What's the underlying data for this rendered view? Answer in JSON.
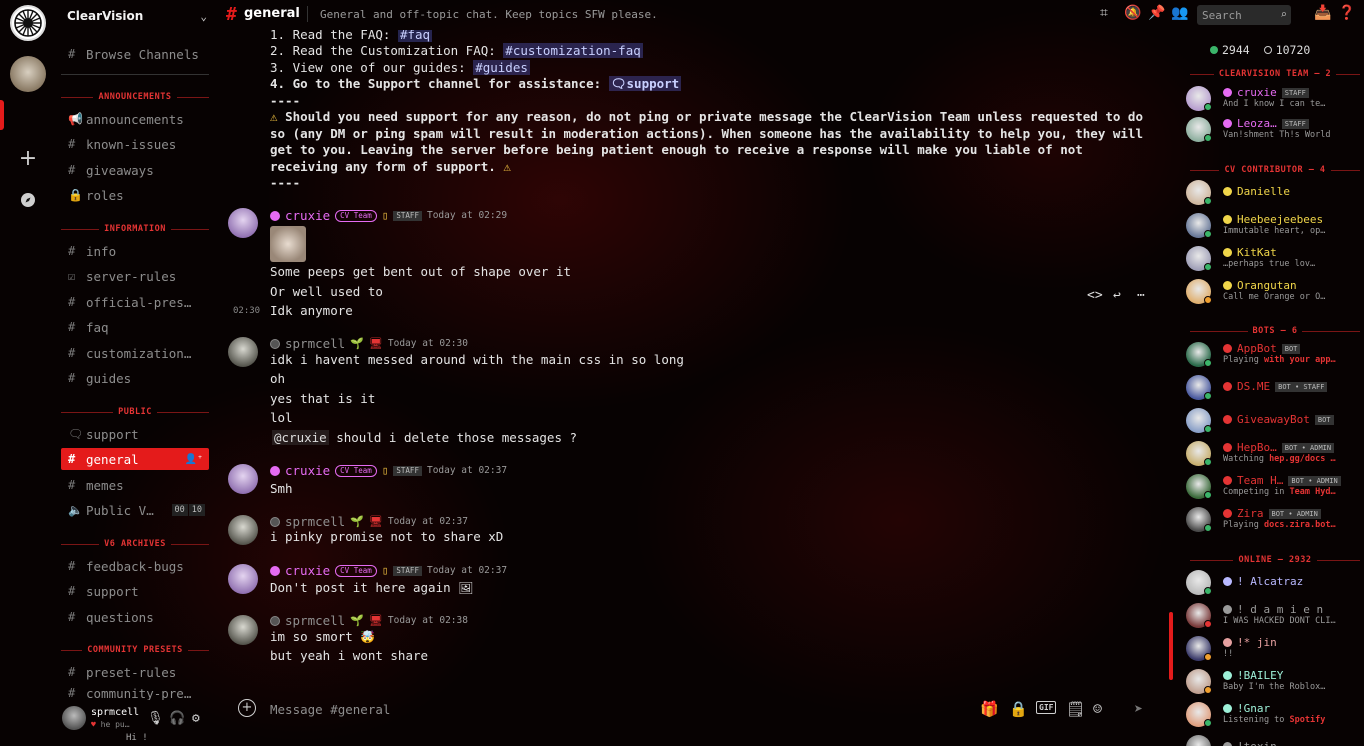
{
  "server": {
    "name": "ClearVision"
  },
  "header": {
    "channel": "general",
    "topic": "General and off-topic chat. Keep topics SFW please.",
    "search_placeholder": "Search"
  },
  "sidebar": {
    "browse": "Browse Channels",
    "categories": {
      "announcements": "ANNOUNCEMENTS",
      "information": "INFORMATION",
      "public": "PUBLIC",
      "v6": "V6 ARCHIVES",
      "community": "COMMUNITY PRESETS"
    },
    "channels": {
      "announcements": "announcements",
      "known_issues": "known-issues",
      "giveaways": "giveaways",
      "roles": "roles",
      "info": "info",
      "server_rules": "server-rules",
      "official_pres": "official-pres…",
      "faq": "faq",
      "customization": "customization…",
      "guides": "guides",
      "support": "support",
      "general": "general",
      "memes": "memes",
      "public_voice": "Public V…",
      "voice_count_a": "00",
      "voice_count_b": "10",
      "feedback_bugs": "feedback-bugs",
      "support_v6": "support",
      "questions": "questions",
      "preset_rules": "preset-rules",
      "community_pre": "community-pre…"
    }
  },
  "user_panel": {
    "name": "sprmcell",
    "status": "he pu…",
    "status_extra": "Hi !"
  },
  "messages": {
    "rules": {
      "l1_text": "1. Read the FAQ: ",
      "l1_chan": "#faq",
      "l2_text": "2. Read the Customization FAQ: ",
      "l2_chan": "#customization-faq",
      "l3_text": "3. View one of our guides: ",
      "l3_chan": "#guides",
      "l4_text": "4. Go to the Support channel for assistance: ",
      "l4_chan": "support",
      "sep1": "----",
      "warn_l1": "Should you need support for any reason, do not ping or private message the ClearVision Team unless requested to do",
      "warn_l2": "so (any DM or ping spam will result in moderation actions). When someone has the availability to help you, they will",
      "warn_l3": "get to you. Leaving the server before being patient enough to receive a response will make you liable of not",
      "warn_l4": "receiving any form of support.",
      "sep2": "----"
    },
    "m1": {
      "author": "cruxie",
      "badge": "CV Team",
      "staff": "STAFF",
      "time": "Today at 02:29",
      "lines": [
        "Some peeps get bent out of shape over it",
        "Or well used to",
        "Idk anymore"
      ],
      "hover_time": "02:30"
    },
    "m2": {
      "author": "sprmcell",
      "time": "Today at 02:30",
      "lines": [
        "idk i havent messed around with the main css in so long",
        "oh",
        "yes that is it",
        "lol"
      ],
      "mention": "@cruxie",
      "mention_rest": " should i delete those messages ?"
    },
    "m3": {
      "author": "cruxie",
      "badge": "CV Team",
      "staff": "STAFF",
      "time": "Today at 02:37",
      "lines": [
        "Smh"
      ]
    },
    "m4": {
      "author": "sprmcell",
      "time": "Today at 02:37",
      "lines": [
        "i pinky promise not to share xD"
      ]
    },
    "m5": {
      "author": "cruxie",
      "badge": "CV Team",
      "staff": "STAFF",
      "time": "Today at 02:37",
      "lines": [
        "Don't post it here again"
      ]
    },
    "m6": {
      "author": "sprmcell",
      "time": "Today at 02:38",
      "lines": [
        "im so smort",
        "but yeah i wont share"
      ]
    }
  },
  "composer": {
    "placeholder": "Message #general"
  },
  "members": {
    "online": "2944",
    "total": "10720",
    "categories": {
      "team": "CLEARVISION TEAM — 2",
      "contrib": "CV CONTRIBUTOR — 4",
      "bots": "BOTS — 6",
      "online": "ONLINE — 2932"
    },
    "list": [
      {
        "name": "cruxie",
        "sub": "And I know I can te…",
        "tag": "STAFF",
        "color": "#e56bf2"
      },
      {
        "name": "Leoza…",
        "sub": "Van!shment Th!s World",
        "tag": "STAFF",
        "color": "#e56bf2"
      },
      {
        "name": "Danielle",
        "sub": "",
        "tag": "",
        "color": "#f0d64a"
      },
      {
        "name": "Heebeejeebees",
        "sub": "Immutable heart, op…",
        "tag": "",
        "color": "#f0d64a"
      },
      {
        "name": "KitKat",
        "sub": "…perhaps true lov…",
        "tag": "",
        "color": "#f0d64a"
      },
      {
        "name": "Orangutan",
        "sub": "Call me Orange or O…",
        "tag": "",
        "color": "#f0d64a"
      },
      {
        "name": "AppBot",
        "sub_pre": "Playing ",
        "sub_hl": "with your app…",
        "tag": "BOT",
        "color": "#e43434"
      },
      {
        "name": "DS.ME",
        "sub": "",
        "tag": "BOT • STAFF",
        "color": "#e43434"
      },
      {
        "name": "GiveawayBot",
        "sub": "",
        "tag": "BOT",
        "color": "#e43434"
      },
      {
        "name": "HepBo…",
        "sub_pre": "Watching ",
        "sub_hl": "hep.gg/docs …",
        "tag": "BOT • ADMIN",
        "color": "#e43434"
      },
      {
        "name": "Team H…",
        "sub_pre": "Competing in ",
        "sub_hl": "Team Hyd…",
        "tag": "BOT • ADMIN",
        "color": "#e43434"
      },
      {
        "name": "Zira",
        "sub_pre": "Playing ",
        "sub_hl": "docs.zira.bot…",
        "tag": "BOT • ADMIN",
        "color": "#e43434"
      },
      {
        "name": "! Alcatraz",
        "sub": "",
        "tag": "",
        "color": "#b9b9ff"
      },
      {
        "name": "! d a m i e n",
        "sub": "I WAS HACKED DONT CLI…",
        "tag": "",
        "color": "#9a9a9a"
      },
      {
        "name": "!* jin",
        "sub": "!!",
        "tag": "",
        "color": "#e6a0a0"
      },
      {
        "name": "!BAILEY",
        "sub": "Baby I'm the Roblox…",
        "tag": "",
        "color": "#9ef0d8"
      },
      {
        "name": "!Gnar",
        "sub_pre": "Listening to ",
        "sub_hl": "Spotify",
        "tag": "",
        "color": "#9ef0d8"
      },
      {
        "name": "!toxin",
        "sub": "",
        "tag": "",
        "color": "#9a9a9a"
      }
    ]
  }
}
